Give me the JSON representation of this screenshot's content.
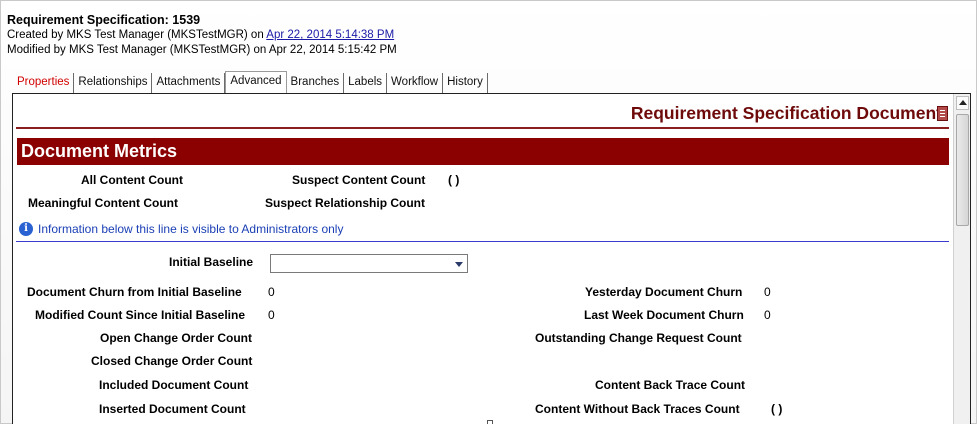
{
  "header": {
    "title": "Requirement Specification: 1539",
    "created_prefix": "Created by MKS Test Manager (MKSTestMGR) on ",
    "created_link": "Apr 22, 2014 5:14:38 PM",
    "modified": "Modified by MKS Test Manager (MKSTestMGR) on Apr 22, 2014 5:15:42 PM"
  },
  "tabs": [
    {
      "label": "Properties"
    },
    {
      "label": "Relationships"
    },
    {
      "label": "Attachments"
    },
    {
      "label": "Advanced"
    },
    {
      "label": "Branches"
    },
    {
      "label": "Labels"
    },
    {
      "label": "Workflow"
    },
    {
      "label": "History"
    }
  ],
  "document": {
    "title": "Requirement Specification Document",
    "section_title": "Document Metrics",
    "all_content_count": "All Content Count",
    "suspect_content_count": "Suspect Content Count",
    "suspect_content_value": "(  )",
    "meaningful_content_count": "Meaningful Content Count",
    "suspect_relationship_count": "Suspect Relationship Count",
    "info_text": "Information below this line is visible to Administrators only",
    "initial_baseline": "Initial Baseline",
    "initial_baseline_value": "",
    "churn_initial_label": "Document Churn from Initial Baseline",
    "churn_initial_value": "0",
    "modified_since_label": "Modified Count Since Initial Baseline",
    "modified_since_value": "0",
    "yesterday_churn_label": "Yesterday Document Churn",
    "yesterday_churn_value": "0",
    "last_week_churn_label": "Last Week Document Churn",
    "last_week_churn_value": "0",
    "open_co_label": "Open Change Order Count",
    "closed_co_label": "Closed Change Order Count",
    "outstanding_cr_label": "Outstanding Change Request Count",
    "included_doc_label": "Included Document Count",
    "inserted_doc_label": "Inserted Document Count",
    "content_back_trace_label": "Content Back Trace Count",
    "content_without_back_label": "Content Without Back Traces Count",
    "content_without_back_value": "(  )"
  }
}
